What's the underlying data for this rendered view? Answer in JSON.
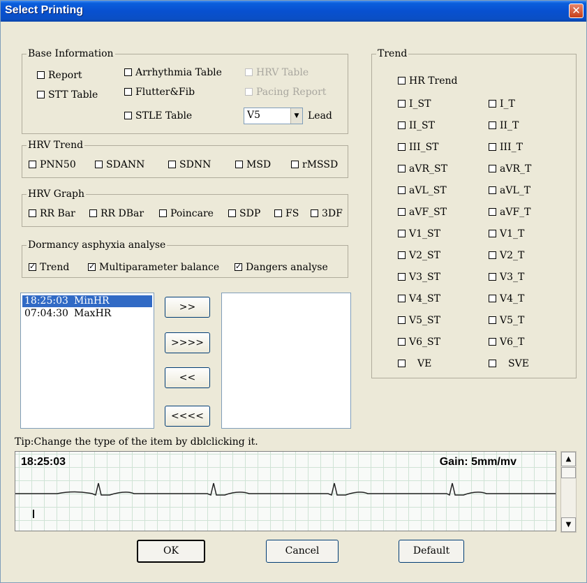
{
  "window": {
    "title": "Select Printing",
    "close_label": "✕"
  },
  "base_info": {
    "legend": "Base Information",
    "report": "Report",
    "stt_table": "STT Table",
    "arrhythmia_table": "Arrhythmia Table",
    "flutter_fib": "Flutter&Fib",
    "stle_table": "STLE Table",
    "hrv_table": "HRV Table",
    "pacing_report": "Pacing Report",
    "lead_value": "V5",
    "lead_label": "Lead"
  },
  "hrv_trend": {
    "legend": "HRV Trend",
    "items": [
      "PNN50",
      "SDANN",
      "SDNN",
      "MSD",
      "rMSSD"
    ]
  },
  "hrv_graph": {
    "legend": "HRV Graph",
    "items": [
      "RR Bar",
      "RR DBar",
      "Poincare",
      "SDP",
      "FS",
      "3DF"
    ]
  },
  "dormancy": {
    "legend": "Dormancy asphyxia analyse",
    "items": [
      "Trend",
      "Multiparameter balance",
      "Dangers analyse"
    ]
  },
  "event_list": [
    {
      "time": "18:25:03",
      "name": "MinHR",
      "selected": true
    },
    {
      "time": "07:04:30",
      "name": "MaxHR",
      "selected": false
    }
  ],
  "transfer_buttons": [
    ">>",
    ">>>>",
    "<<",
    "<<<<"
  ],
  "trend": {
    "legend": "Trend",
    "hr_trend": "HR Trend",
    "st_items": [
      "I_ST",
      "II_ST",
      "III_ST",
      "aVR_ST",
      "aVL_ST",
      "aVF_ST",
      "V1_ST",
      "V2_ST",
      "V3_ST",
      "V4_ST",
      "V5_ST",
      "V6_ST",
      "VE"
    ],
    "t_items": [
      "I_T",
      "II_T",
      "III_T",
      "aVR_T",
      "aVL_T",
      "aVF_T",
      "V1_T",
      "V2_T",
      "V3_T",
      "V4_T",
      "V5_T",
      "V6_T",
      "SVE"
    ]
  },
  "tip": "Tip:Change the type of the item by dblclicking it.",
  "ecg": {
    "time": "18:25:03",
    "gain": "Gain: 5mm/mv"
  },
  "buttons": {
    "ok": "OK",
    "cancel": "Cancel",
    "default": "Default"
  },
  "colors": {
    "title_bar": "#0a5fdc",
    "dialog_bg": "#ece9d8",
    "selection": "#316ac5",
    "close_button": "#c63f19"
  },
  "icons": {
    "close": "close-icon",
    "dropdown": "chevron-down-icon",
    "scroll_up": "scroll-up-arrow-icon",
    "scroll_down": "scroll-down-arrow-icon"
  }
}
